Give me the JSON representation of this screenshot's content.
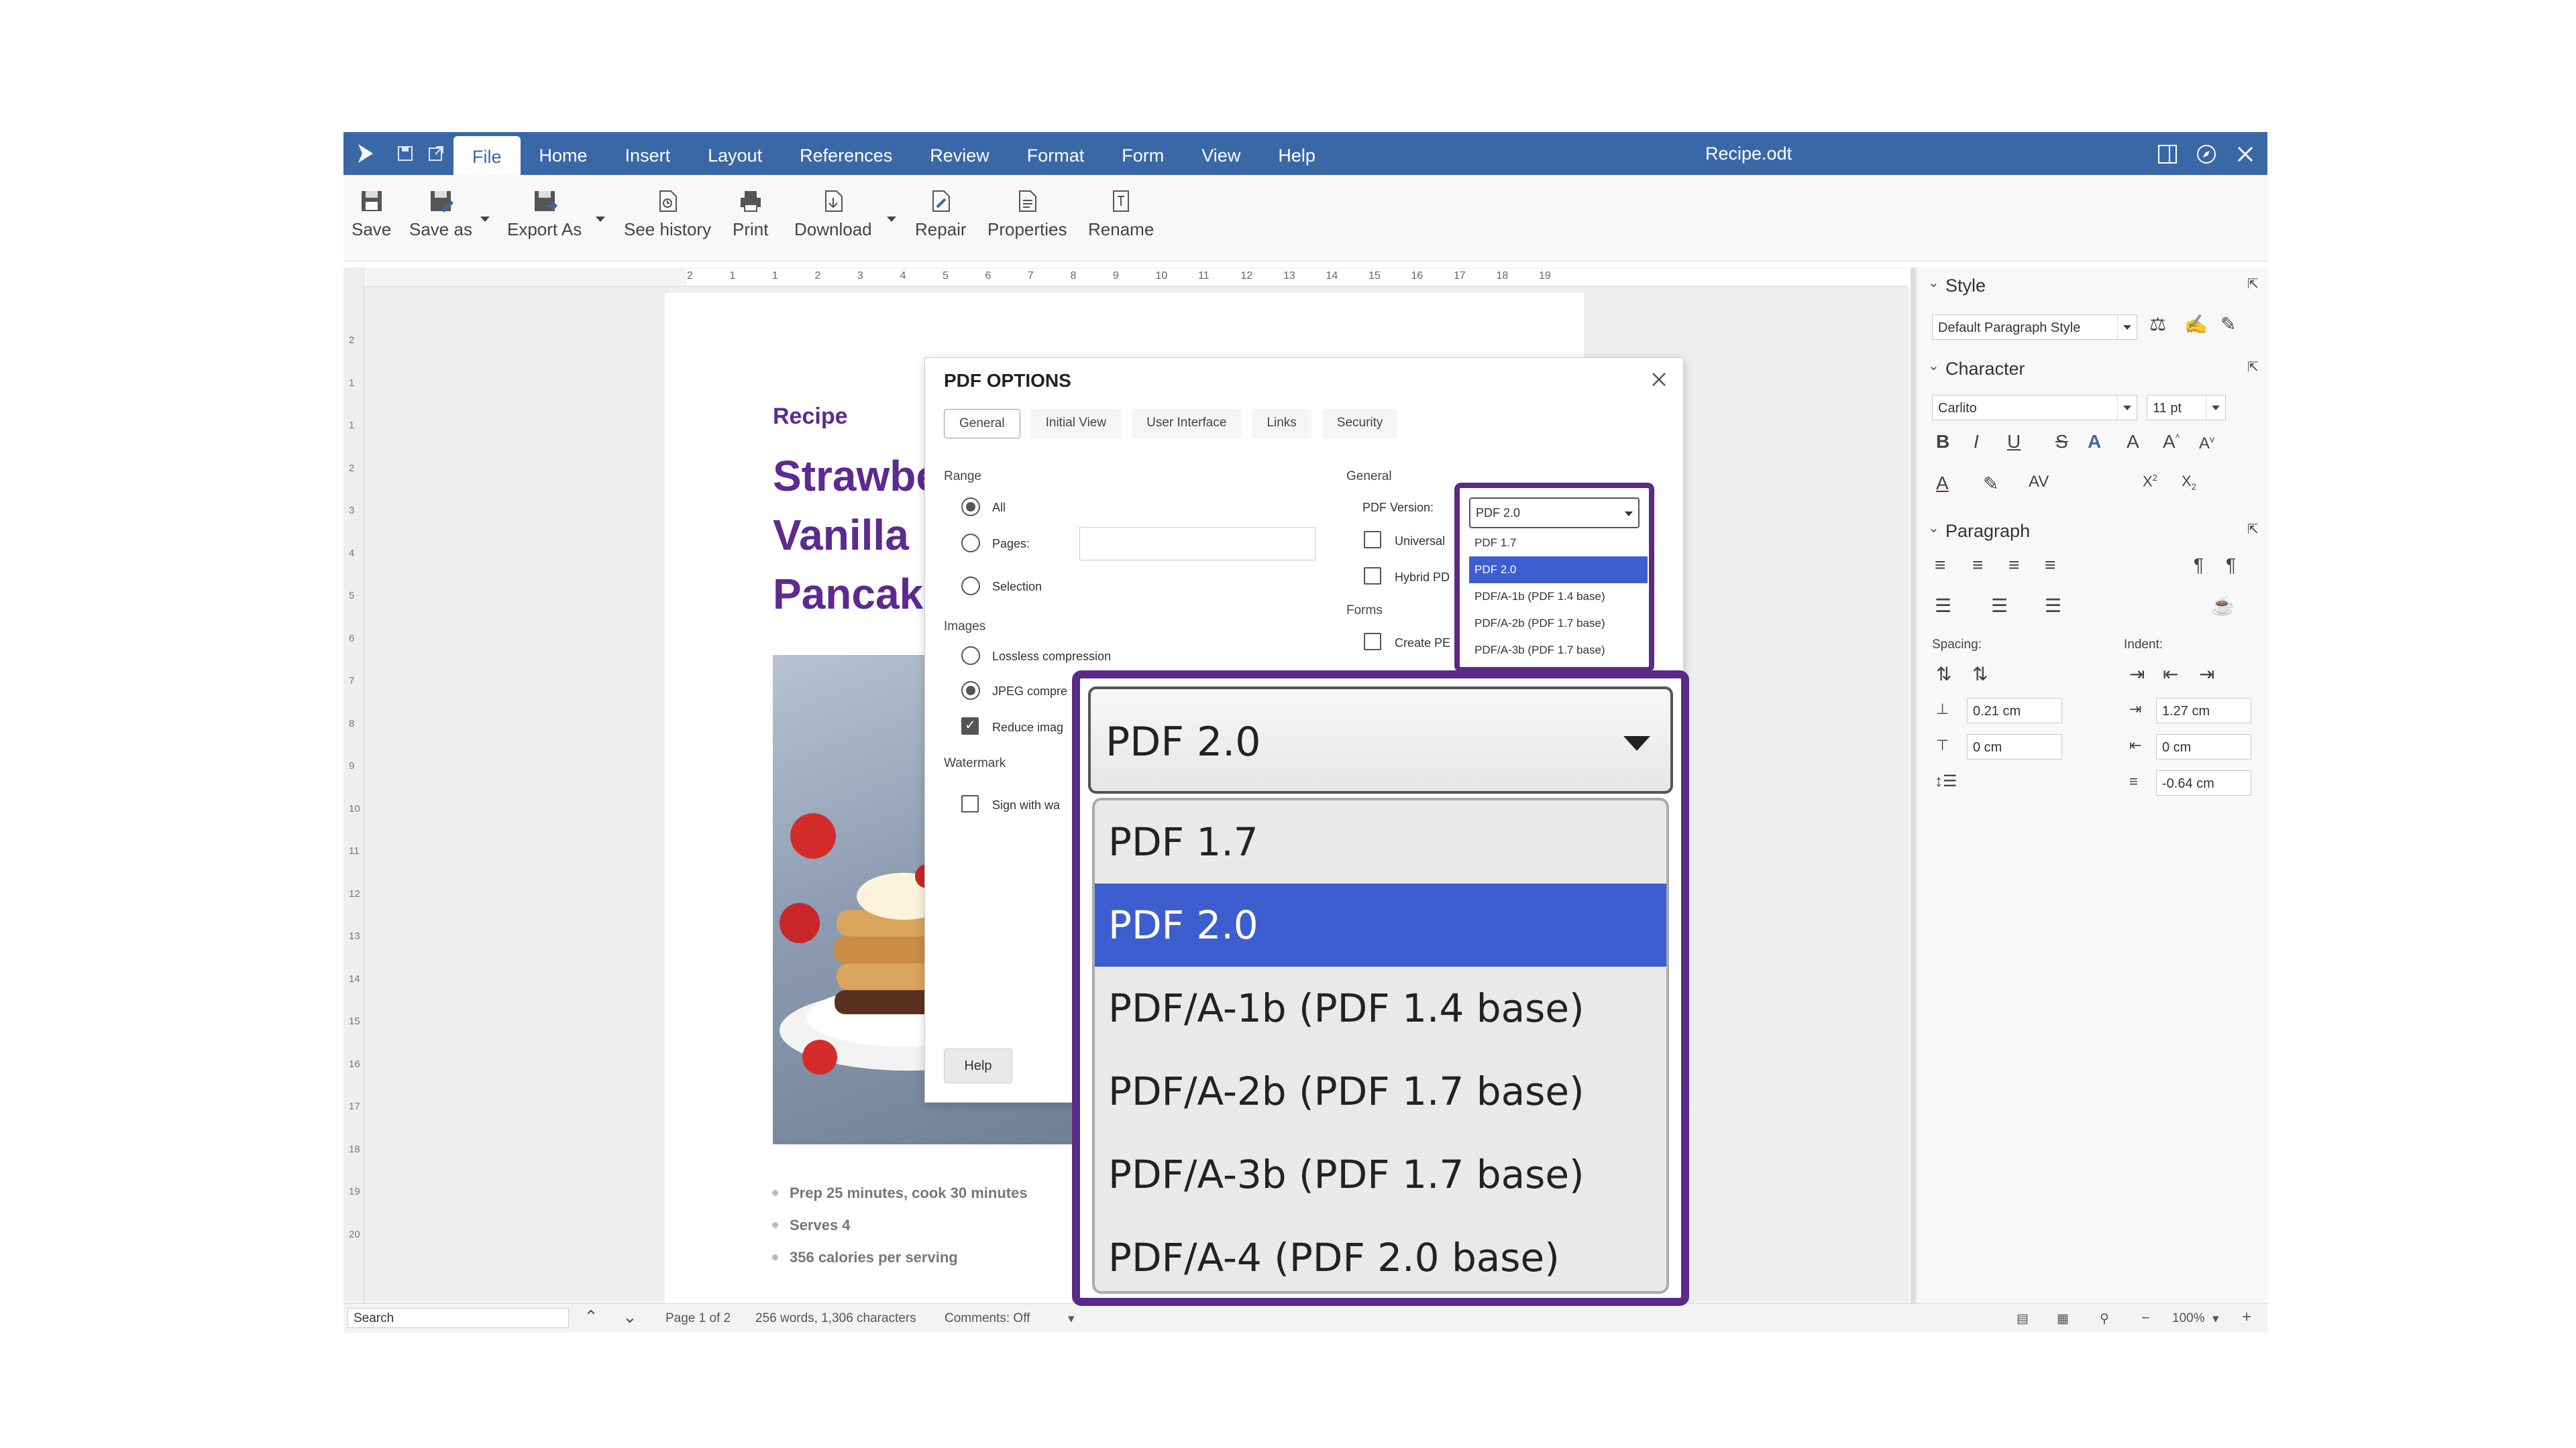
{
  "app": {
    "title": "Recipe.odt",
    "menu": [
      "File",
      "Home",
      "Insert",
      "Layout",
      "References",
      "Review",
      "Format",
      "Form",
      "View",
      "Help"
    ]
  },
  "toolbar": {
    "save": "Save",
    "save_as": "Save as",
    "export_as": "Export As",
    "see_history": "See history",
    "print": "Print",
    "download": "Download",
    "repair": "Repair",
    "properties": "Properties",
    "rename": "Rename"
  },
  "ruler": {
    "ticks": [
      "2",
      "1",
      "1",
      "2",
      "3",
      "4",
      "5",
      "6",
      "7",
      "8",
      "9",
      "10",
      "11",
      "12",
      "13",
      "14",
      "15",
      "16",
      "17",
      "18",
      "19"
    ],
    "vticks": [
      "2",
      "1",
      "1",
      "2",
      "3",
      "4",
      "5",
      "6",
      "7",
      "8",
      "9",
      "10",
      "11",
      "12",
      "13",
      "14",
      "15",
      "16",
      "17",
      "18",
      "19",
      "20"
    ]
  },
  "document": {
    "kicker": "Recipe",
    "heading": [
      "Strawbe",
      "Vanilla",
      "Pancake"
    ],
    "bullets": [
      "Prep 25 minutes, cook 30 minutes",
      "Serves 4",
      "356 calories per serving"
    ]
  },
  "dialog": {
    "title": "PDF OPTIONS",
    "tabs": [
      "General",
      "Initial View",
      "User Interface",
      "Links",
      "Security"
    ],
    "range_label": "Range",
    "range_all": "All",
    "range_pages": "Pages:",
    "range_selection": "Selection",
    "images_label": "Images",
    "lossless": "Lossless compression",
    "jpeg": "JPEG compre",
    "reduce": "Reduce imag",
    "watermark_label": "Watermark",
    "sign": "Sign with wa",
    "general_label": "General",
    "pdf_version_label": "PDF Version:",
    "universal": "Universal",
    "hybrid": "Hybrid PD",
    "forms_label": "Forms",
    "create_pdf": "Create PE",
    "help": "Help"
  },
  "pdf_version": {
    "selected": "PDF 2.0",
    "small_options": [
      "PDF 1.7",
      "PDF 2.0",
      "PDF/A-1b (PDF 1.4 base)",
      "PDF/A-2b (PDF 1.7 base)",
      "PDF/A-3b (PDF 1.7 base)"
    ],
    "zoom_options": [
      "PDF 1.7",
      "PDF 2.0",
      "PDF/A-1b (PDF 1.4 base)",
      "PDF/A-2b (PDF 1.7 base)",
      "PDF/A-3b (PDF 1.7 base)",
      "PDF/A-4 (PDF 2.0 base)"
    ]
  },
  "sidebar": {
    "style_header": "Style",
    "style_value": "Default Paragraph Style",
    "character_header": "Character",
    "font_value": "Carlito",
    "size_value": "11 pt",
    "paragraph_header": "Paragraph",
    "spacing_label": "Spacing:",
    "indent_label": "Indent:",
    "spacing_above": "0.21 cm",
    "spacing_below": "0 cm",
    "indent_before": "1.27 cm",
    "indent_after": "0 cm",
    "indent_first": "-0.64 cm"
  },
  "status": {
    "search_placeholder": "Search",
    "page": "Page 1 of 2",
    "words": "256 words, 1,306 characters",
    "comments": "Comments: Off",
    "zoom": "100%"
  },
  "colors": {
    "titlebar": "#3a68a7",
    "accent_purple": "#5b2a86",
    "selection_blue": "#3d5ecf"
  }
}
